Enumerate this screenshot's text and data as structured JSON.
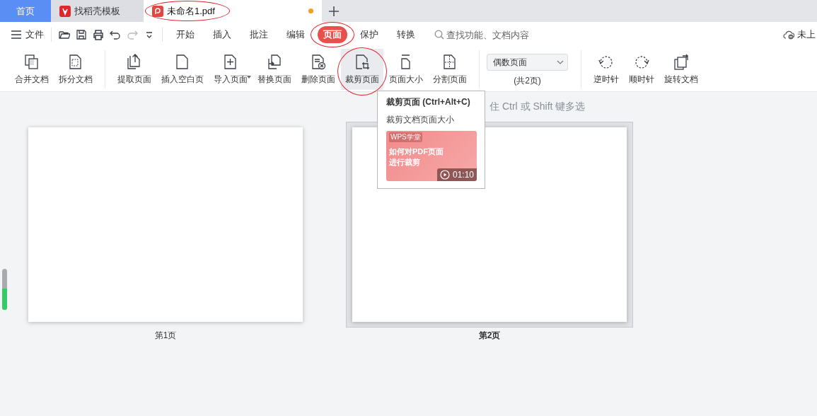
{
  "tabs": [
    {
      "label": "首页",
      "kind": "home",
      "selected": false,
      "circled": false
    },
    {
      "label": "找稻壳模板",
      "kind": "app",
      "selected": false,
      "circled": false
    },
    {
      "label": "未命名1.pdf",
      "kind": "pdf",
      "selected": true,
      "circled": true,
      "unsaved": true
    }
  ],
  "menu": {
    "file_label": "文件",
    "quick_actions": [
      {
        "disabled": false
      },
      {
        "disabled": false
      },
      {
        "disabled": false
      },
      {
        "disabled": false
      },
      {
        "disabled": true
      },
      {
        "disabled": false
      }
    ],
    "tabs": [
      {
        "label": "开始",
        "selected": false,
        "circled": false
      },
      {
        "label": "插入",
        "selected": false,
        "circled": false
      },
      {
        "label": "批注",
        "selected": false,
        "circled": false
      },
      {
        "label": "编辑",
        "selected": false,
        "circled": false
      },
      {
        "label": "页面",
        "selected": true,
        "circled": true
      },
      {
        "label": "保护",
        "selected": false,
        "circled": false
      },
      {
        "label": "转换",
        "selected": false,
        "circled": false
      }
    ],
    "search": {
      "placeholder": "查找功能、文档内容"
    },
    "cloud_status": "未上"
  },
  "ribbon": {
    "groups": [
      {
        "kind": "tools",
        "tools": [
          {
            "label": "合并文档",
            "highlighted": false,
            "circled": false
          },
          {
            "label": "拆分文档",
            "highlighted": false,
            "circled": false
          }
        ]
      },
      {
        "kind": "tools",
        "tools": [
          {
            "label": "提取页面",
            "highlighted": false,
            "circled": false
          },
          {
            "label": "插入空白页",
            "highlighted": false,
            "circled": false
          },
          {
            "label": "导入页面",
            "highlighted": false,
            "circled": false,
            "dropdown": true
          },
          {
            "label": "替换页面",
            "highlighted": false,
            "circled": false
          },
          {
            "label": "删除页面",
            "highlighted": false,
            "circled": false
          },
          {
            "label": "裁剪页面",
            "highlighted": true,
            "circled": true
          },
          {
            "label": "页面大小",
            "highlighted": false,
            "circled": false
          },
          {
            "label": "分割页面",
            "highlighted": false,
            "circled": false
          }
        ]
      },
      {
        "kind": "select",
        "value": "偶数页面",
        "caption": "(共2页)"
      },
      {
        "kind": "tools",
        "tools": [
          {
            "label": "逆时针",
            "highlighted": false,
            "circled": false
          },
          {
            "label": "顺时针",
            "highlighted": false,
            "circled": false
          },
          {
            "label": "旋转文档",
            "highlighted": false,
            "circled": false
          }
        ]
      }
    ]
  },
  "hint": "住 Ctrl 或 Shift 键多选",
  "tooltip": {
    "title": "裁剪页面 (Ctrl+Alt+C)",
    "description": "裁剪文档页面大小",
    "video": {
      "badge": "WPS学堂",
      "title_lines": [
        "如何对PDF页面",
        "进行裁剪"
      ],
      "duration": "01:10"
    }
  },
  "pages": [
    {
      "label": "第1页",
      "selected": false
    },
    {
      "label": "第2页",
      "selected": true
    }
  ],
  "zoom_slider": {
    "level": 0.52
  }
}
